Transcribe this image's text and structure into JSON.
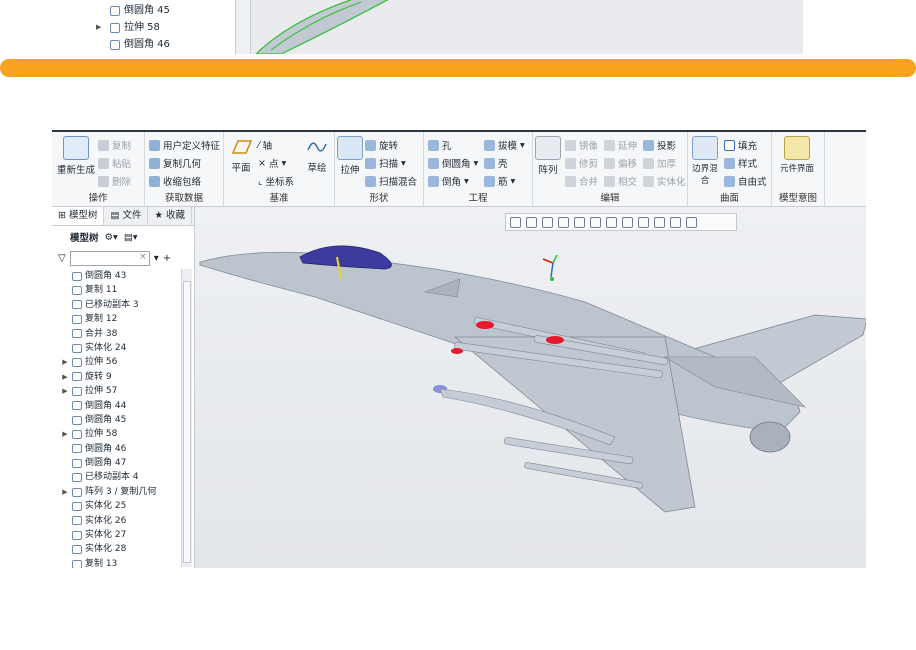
{
  "top_tree": [
    {
      "label": "倒圆角 45",
      "icon": "round-icon",
      "expand": false
    },
    {
      "label": "拉伸 58",
      "icon": "extrude-icon",
      "expand": true
    },
    {
      "label": "倒圆角 46",
      "icon": "round-icon",
      "expand": false
    }
  ],
  "ribbon": {
    "groups": {
      "operation": "操作",
      "get_data": "获取数据",
      "datum": "基准",
      "shape": "形状",
      "engineering": "工程",
      "edit": "编辑",
      "surface": "曲面",
      "model_intent": "模型意图"
    },
    "regenerate": "重新生成",
    "copy": "复制",
    "paste": "粘贴",
    "delete": "删除",
    "user_defined_feature": "用户定义特征",
    "copy_geometry": "复制几何",
    "shrinkwrap": "收缩包络",
    "plane": "平面",
    "axis": "轴",
    "point": "点",
    "coordinate_system": "坐标系",
    "sketch": "草绘",
    "extrude": "拉伸",
    "revolve": "旋转",
    "sweep": "扫描",
    "swept_blend": "扫描混合",
    "hole": "孔",
    "round": "倒圆角",
    "chamfer": "倒角",
    "draft": "拔模",
    "shell": "壳",
    "rib": "筋",
    "pattern": "阵列",
    "mirror": "镜像",
    "trim": "修剪",
    "merge": "合并",
    "extend": "延伸",
    "offset": "偏移",
    "intersect": "相交",
    "project": "投影",
    "thicken": "加厚",
    "solidify": "实体化",
    "boundary_blend": "边界混合",
    "fill": "填充",
    "style": "样式",
    "freestyle": "自由式",
    "component_interface": "元件界面"
  },
  "panel": {
    "tabs": [
      "模型树",
      "文件",
      "收藏"
    ],
    "tree_title": "模型树",
    "filter_placeholder": ""
  },
  "tree_items": [
    {
      "label": "倒圆角 43",
      "icon": "round-icon",
      "expand": false
    },
    {
      "label": "复制 11",
      "icon": "copy-icon",
      "expand": false
    },
    {
      "label": "已移动副本 3",
      "icon": "moved-copy-icon",
      "expand": false
    },
    {
      "label": "复制 12",
      "icon": "copy-icon",
      "expand": false
    },
    {
      "label": "合并 38",
      "icon": "merge-icon",
      "expand": false
    },
    {
      "label": "实体化 24",
      "icon": "solidify-icon",
      "expand": false
    },
    {
      "label": "拉伸 56",
      "icon": "extrude-icon",
      "expand": true
    },
    {
      "label": "旋转 9",
      "icon": "revolve-icon",
      "expand": true
    },
    {
      "label": "拉伸 57",
      "icon": "extrude-icon",
      "expand": true
    },
    {
      "label": "倒圆角 44",
      "icon": "round-icon",
      "expand": false
    },
    {
      "label": "倒圆角 45",
      "icon": "round-icon",
      "expand": false
    },
    {
      "label": "拉伸 58",
      "icon": "extrude-icon",
      "expand": true
    },
    {
      "label": "倒圆角 46",
      "icon": "round-icon",
      "expand": false
    },
    {
      "label": "倒圆角 47",
      "icon": "round-icon",
      "expand": false
    },
    {
      "label": "已移动副本 4",
      "icon": "moved-copy-icon",
      "expand": false
    },
    {
      "label": "阵列 3 / 复制几何",
      "icon": "pattern-icon",
      "expand": true
    },
    {
      "label": "实体化 25",
      "icon": "solidify-icon",
      "expand": false
    },
    {
      "label": "实体化 26",
      "icon": "solidify-icon",
      "expand": false
    },
    {
      "label": "实体化 27",
      "icon": "solidify-icon",
      "expand": false
    },
    {
      "label": "实体化 28",
      "icon": "solidify-icon",
      "expand": false
    },
    {
      "label": "复制 13",
      "icon": "copy-icon",
      "expand": false
    }
  ],
  "view_toolbar_icons": [
    "refit-icon",
    "zoom-in-icon",
    "zoom-out-icon",
    "repaint-icon",
    "view-normal-icon",
    "saved-orientations-icon",
    "view-manager-icon",
    "display-style-icon",
    "perspective-icon",
    "datum-display-icon",
    "annotation-display-icon",
    "spin-center-icon"
  ],
  "colors": {
    "orange": "#f8a21f",
    "airframe": "#b8c0cb",
    "missile_tip": "#e8192c",
    "canopy": "#3d3c9e",
    "model_green": "#2fbf2f"
  }
}
